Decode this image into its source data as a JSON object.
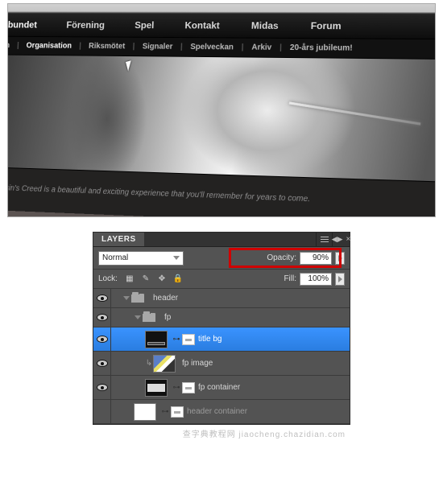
{
  "nav": {
    "items": [
      "Förbundet",
      "Förening",
      "Spel",
      "Kontakt",
      "Midas",
      "Forum"
    ]
  },
  "subnav": {
    "items": [
      "ision",
      "Organisation",
      "Riksmötet",
      "Signaler",
      "Spelveckan",
      "Arkiv",
      "20-års jubileum!"
    ]
  },
  "hero": {
    "caption": "Assassin's Creed is a beautiful and exciting experience that you'll remember for years to come."
  },
  "panel": {
    "tab": "LAYERS",
    "blend_mode": "Normal",
    "opacity_label": "Opacity:",
    "opacity_value": "90%",
    "lock_label": "Lock:",
    "fill_label": "Fill:",
    "fill_value": "100%",
    "layers": {
      "header": "header",
      "fp": "fp",
      "title_bg": "title bg",
      "fp_image": "fp image",
      "fp_container": "fp container",
      "header_container": "header container"
    }
  },
  "watermark": "查字典教程网  jiaocheng.chazidian.com"
}
